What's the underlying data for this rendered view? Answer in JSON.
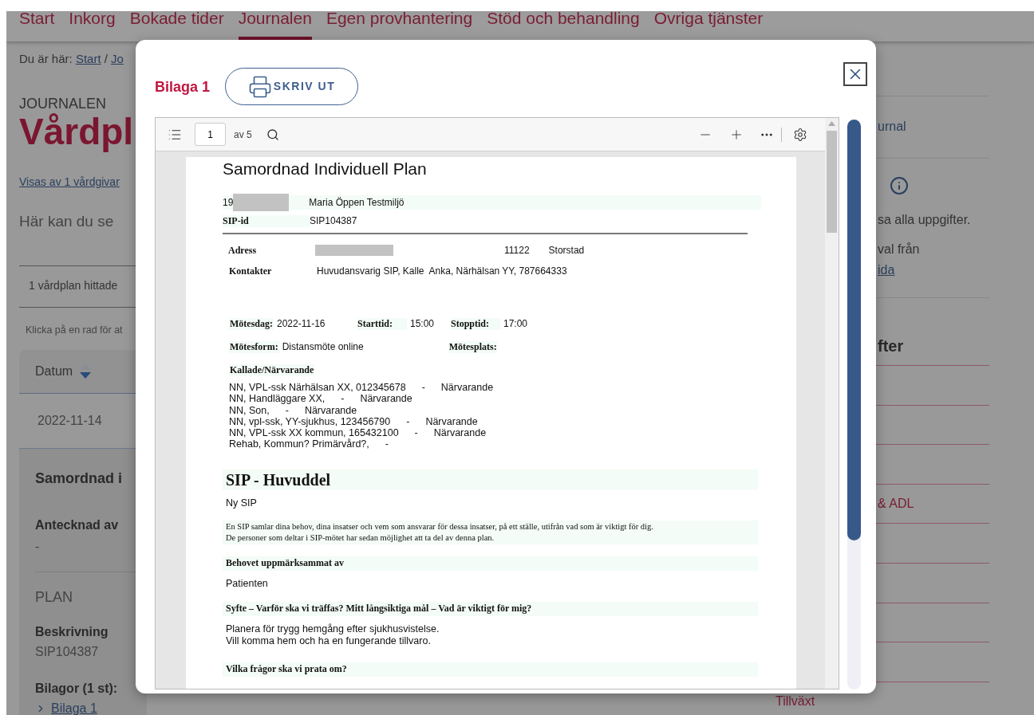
{
  "nav": [
    {
      "label": "Start",
      "selected": false
    },
    {
      "label": "Inkorg",
      "selected": false
    },
    {
      "label": "Bokade tider",
      "selected": false
    },
    {
      "label": "Journalen",
      "selected": true
    },
    {
      "label": "Egen provhantering",
      "selected": false
    },
    {
      "label": "Stöd och behandling",
      "selected": false
    },
    {
      "label": "Ovriga tjänster",
      "selected": false
    }
  ],
  "breadcrumb": {
    "label": "Du är här:",
    "links": [
      "Start",
      "Jo"
    ],
    "separator": "/"
  },
  "page": {
    "section": "JOURNALEN",
    "title": "Vårdpl",
    "providers_link": "Visas av 1 vårdgivar",
    "intro": "Här kan du se",
    "count": "1 vårdplan hittade",
    "hint": "Klicka på en rad för at"
  },
  "table": {
    "column": "Datum",
    "rows": [
      {
        "date": "2022-11-14"
      }
    ]
  },
  "detail": {
    "title": "Samordnad i",
    "author_label": "Antecknad av",
    "author": "-",
    "plan_heading": "PLAN",
    "description_label": "Beskrivning",
    "description": "SIP104387",
    "attachments_label": "Bilagor (1 st):",
    "attachments": [
      "Bilaga 1"
    ]
  },
  "side": {
    "link": "urnal",
    "text_1": "sa alla uppgifter.",
    "text_2": "val från",
    "link_2": "ida",
    "heading": "fter",
    "links": [
      "& ADL",
      "Tillväxt"
    ]
  },
  "modal": {
    "title": "Bilaga 1",
    "print_button": "SKRIV UT"
  },
  "viewer": {
    "page": "1",
    "page_count": "av 5"
  },
  "document": {
    "title": "Samordnad Individuell Plan",
    "patient": {
      "prefix": "19",
      "name": "Maria Öppen Testmiljö"
    },
    "sip_id": {
      "label": "SIP-id",
      "value": "SIP104387"
    },
    "address": {
      "label": "Adress",
      "postcode": "11122",
      "city": "Storstad"
    },
    "contacts": {
      "label": "Kontakter",
      "value": "Huvudansvarig SIP, Kalle  Anka, Närhälsan YY, 787664333"
    },
    "meeting": {
      "date_label": "Mötesdag:",
      "date": "2022-11-16",
      "start_label": "Starttid:",
      "start": "15:00",
      "stop_label": "Stopptid:",
      "stop": "17:00",
      "form_label": "Mötesform:",
      "form": "Distansmöte online",
      "place_label": "Mötesplats:"
    },
    "attendees": {
      "heading": "Kallade/Närvarande",
      "items": [
        {
          "name": "NN, VPL-ssk Närhälsan XX, 012345678",
          "dash": "-",
          "status": "Närvarande"
        },
        {
          "name": "NN, Handläggare XX,",
          "dash": "-",
          "status": "Närvarande"
        },
        {
          "name": "NN, Son,",
          "dash": "-",
          "status": "Närvarande"
        },
        {
          "name": "NN, vpl-ssk, YY-sjukhus, 123456790",
          "dash": "-",
          "status": "Närvarande"
        },
        {
          "name": "NN, VPL-ssk XX kommun, 165432100",
          "dash": "-",
          "status": "Närvarande"
        },
        {
          "name": "Rehab, Kommun? Primärvård?,",
          "dash": "-"
        }
      ]
    },
    "blocks": [
      {
        "kind": "major",
        "lines": [
          "SIP - Huvuddel"
        ]
      },
      {
        "kind": "text",
        "lines": [
          "Ny SIP"
        ]
      },
      {
        "kind": "note",
        "lines": [
          "En SIP samlar dina behov, dina insatser och vem som ansvarar för dessa insatser, på ett ställe, utifrån vad som är viktigt för dig.",
          "De personer som deltar i SIP-mötet har sedan möjlighet att ta del av denna plan."
        ]
      },
      {
        "kind": "sub",
        "lines": [
          "Behovet uppmärksammat av"
        ]
      },
      {
        "kind": "text",
        "lines": [
          "Patienten"
        ]
      },
      {
        "kind": "sub",
        "lines": [
          "Syfte – Varför ska vi träffas? Mitt långsiktiga mål – Vad är viktigt för mig?"
        ]
      },
      {
        "kind": "text",
        "lines": [
          "Planera för trygg hemgång efter sjukhusvistelse.",
          "Vill komma hem och ha en fungerande tillvaro."
        ]
      },
      {
        "kind": "sub",
        "lines": [
          "Vilka frågor ska vi prata om?"
        ]
      }
    ]
  }
}
